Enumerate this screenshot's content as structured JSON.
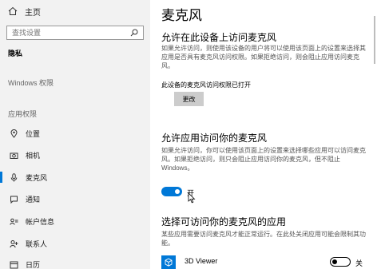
{
  "sidebar": {
    "home_label": "主页",
    "search_placeholder": "查找设置",
    "section_title": "隐私",
    "group_windows": "Windows 权限",
    "group_app": "应用权限",
    "items": [
      {
        "label": "位置",
        "icon": "location-icon"
      },
      {
        "label": "相机",
        "icon": "camera-icon"
      },
      {
        "label": "麦克风",
        "icon": "microphone-icon",
        "active": true
      },
      {
        "label": "通知",
        "icon": "notification-icon"
      },
      {
        "label": "帐户信息",
        "icon": "account-info-icon"
      },
      {
        "label": "联系人",
        "icon": "contacts-icon"
      },
      {
        "label": "日历",
        "icon": "calendar-icon"
      }
    ]
  },
  "main": {
    "title": "麦克风",
    "device_section": {
      "heading": "允许在此设备上访问麦克风",
      "description": "如果允许访问，则使用该设备的用户将可以使用该页面上的设置来选择其应用是否具有麦克风访问权限。如果拒绝访问，则会阻止应用访问麦克风。",
      "status": "此设备的麦克风访问权限已打开",
      "change_button": "更改"
    },
    "app_section": {
      "heading": "允许应用访问你的麦克风",
      "description": "如果允许访问，你可以使用该页面上的设置来选择哪些应用可以访问麦克风。如果拒绝访问，则只会阻止应用访问你的麦克风，但不阻止 Windows。",
      "toggle_label": "开",
      "toggle_on": true
    },
    "choose_section": {
      "heading": "选择可访问你的麦克风的应用",
      "description": "某些应用需要访问麦克风才能正常运行。在此处关闭应用可能会限制其功能。"
    },
    "apps": [
      {
        "name": "3D Viewer",
        "toggle_label": "关",
        "toggle_on": false
      }
    ]
  },
  "colors": {
    "accent": "#0078d7",
    "sidebar_bg": "#f2f2f2",
    "button_bg": "#cccccc"
  }
}
